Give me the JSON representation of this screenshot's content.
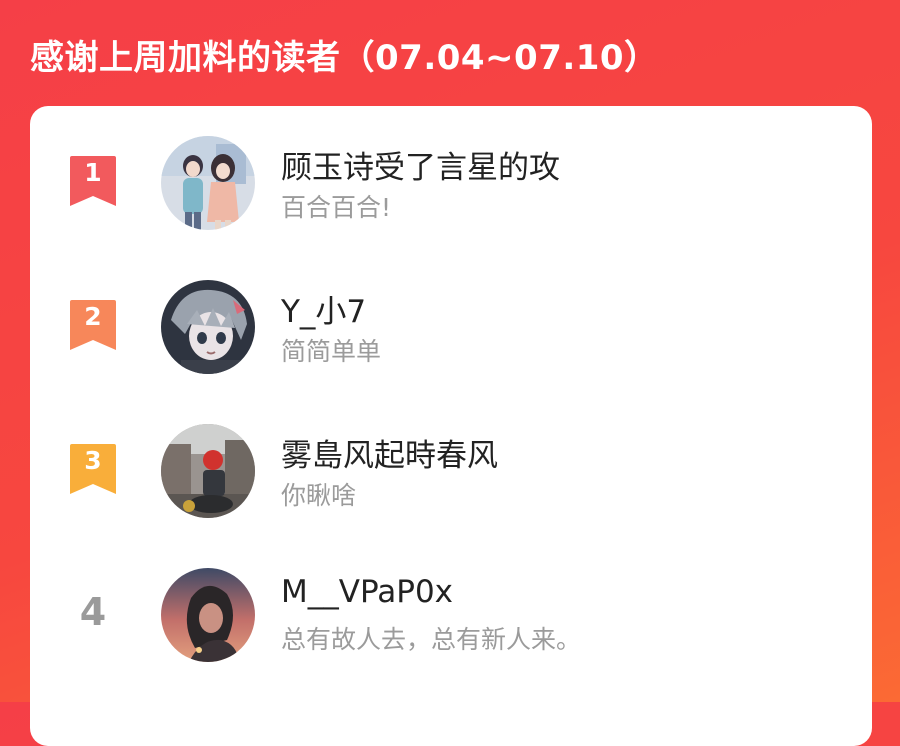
{
  "header": {
    "title": "感谢上周加料的读者（07.04~07.10）"
  },
  "colors": {
    "background_start": "#f53f47",
    "background_end": "#fb6a34",
    "rank_1": "#f25a5d",
    "rank_2": "#f7875a",
    "rank_3": "#f9ae3a",
    "rank_other": "#9a9a9a"
  },
  "readers": [
    {
      "rank": "1",
      "name": "顾玉诗受了言星的攻",
      "note": "百合百合!",
      "avatar_icon": "avatar-anime-couple-icon"
    },
    {
      "rank": "2",
      "name": "Y_小7",
      "note": "简简单单",
      "avatar_icon": "avatar-anime-boy-icon"
    },
    {
      "rank": "3",
      "name": "雾島风起時春风",
      "note": "你瞅啥",
      "avatar_icon": "avatar-rider-icon"
    },
    {
      "rank": "4",
      "name": "M__VPaP0x",
      "note": "总有故人去，总有新人来。",
      "avatar_icon": "avatar-portrait-icon"
    }
  ]
}
